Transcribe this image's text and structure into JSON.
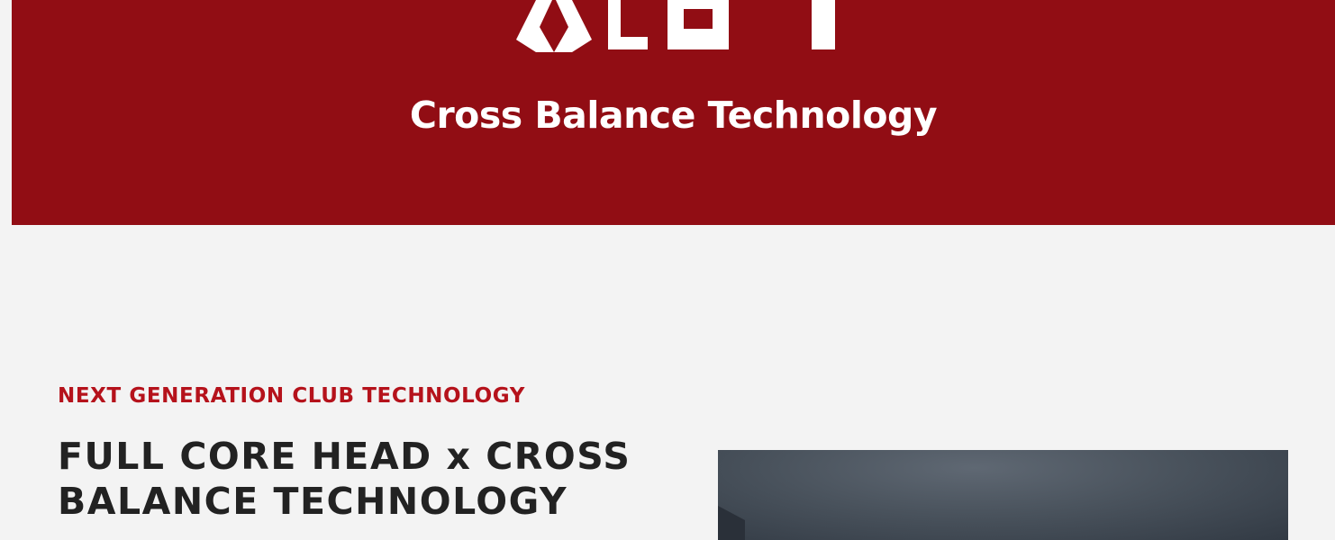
{
  "hero": {
    "logo_text": "XCBT",
    "tagline": "Cross Balance Technology",
    "background_color": "#910d14"
  },
  "section": {
    "eyebrow": "NEXT GENERATION CLUB TECHNOLOGY",
    "headline_line1": "FULL CORE HEAD x CROSS",
    "headline_line2": "BALANCE TECHNOLOGY",
    "accent_color": "#b5121b"
  },
  "media": {
    "image_alt": "golf club head product photo"
  }
}
